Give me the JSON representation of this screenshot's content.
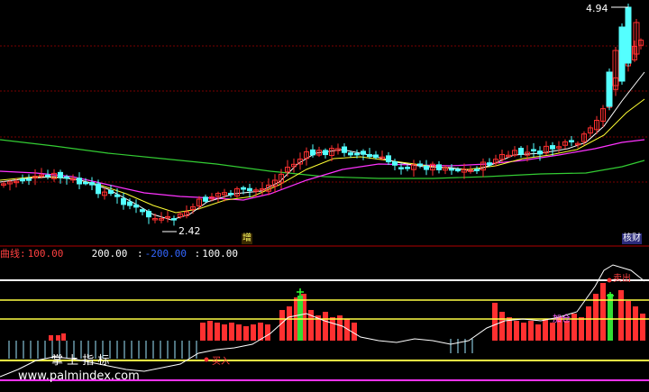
{
  "colors": {
    "background": "#000000",
    "up": "#ff3030",
    "down": "#54ffff",
    "ma_short": "#ffffff",
    "ma_mid": "#ffff33",
    "ma_long": "#ff33ff",
    "ma_longer": "#33cc33",
    "grid": "#7a0000",
    "osc_line": "#ffffff",
    "level_high": "#ffffff",
    "level_mid": "#ffff44",
    "level_low": "#ff33ff"
  },
  "price_panel": {
    "high_label": "4.94",
    "low_label": "2.42",
    "tag_zeng": "增",
    "tag_fin": "核财"
  },
  "indicator_legend": {
    "name": "曲线:",
    "value1": "100.00",
    "sep2": ":",
    "value2": "200.00",
    "sep3": ":",
    "value3": "-200.00",
    "sep4": ":",
    "value4": "100.00"
  },
  "indicator_panel": {
    "signal_top": "卖出",
    "signal_bottom": "买入",
    "signal_mid": "加仓"
  },
  "watermark": {
    "cn": "掌 上 指 标",
    "url": "www.palmindex.com"
  }
}
